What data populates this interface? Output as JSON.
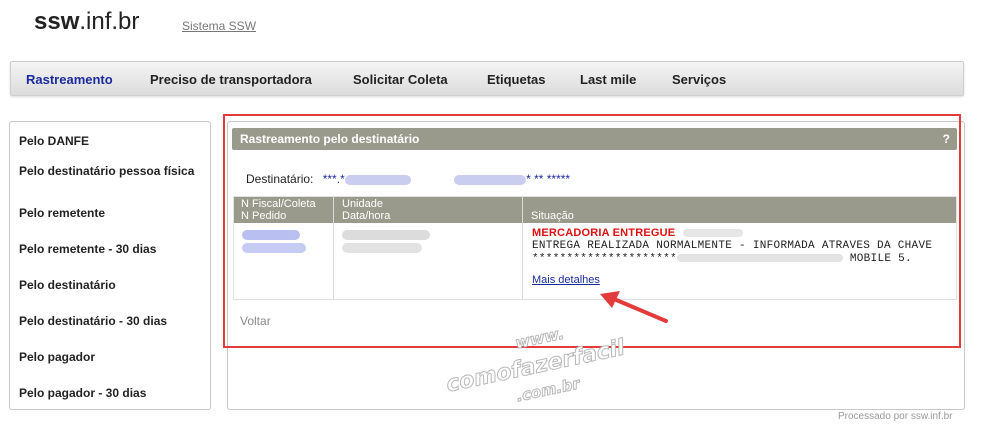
{
  "header": {
    "brand_bold": "ssw",
    "brand_rest": ".inf.br",
    "sys_link": "Sistema SSW"
  },
  "nav": {
    "items": [
      {
        "label": "Rastreamento",
        "active": true
      },
      {
        "label": "Preciso de transportadora"
      },
      {
        "label": "Solicitar Coleta"
      },
      {
        "label": "Etiquetas"
      },
      {
        "label": "Last mile"
      },
      {
        "label": "Serviços"
      }
    ]
  },
  "sidebar": {
    "items": [
      {
        "label": "Pelo DANFE"
      },
      {
        "label": "Pelo destinatário pessoa física"
      },
      {
        "label": "Pelo remetente"
      },
      {
        "label": "Pelo remetente - 30 dias"
      },
      {
        "label": "Pelo destinatário"
      },
      {
        "label": "Pelo destinatário - 30 dias"
      },
      {
        "label": "Pelo pagador"
      },
      {
        "label": "Pelo pagador - 30 dias"
      }
    ]
  },
  "panel": {
    "title": "Rastreamento pelo destinatário",
    "help": "?",
    "dest_label": "Destinatário:",
    "dest_value_prefix": "***.*",
    "dest_value_suffix": "* ** *****",
    "table": {
      "col1_line1": "N Fiscal/Coleta",
      "col1_line2": "N Pedido",
      "col2_line1": "Unidade",
      "col2_line2": "Data/hora",
      "col3": "Situação"
    },
    "row": {
      "status_title": "MERCADORIA ENTREGUE",
      "status_line1": "ENTREGA REALIZADA NORMALMENTE - INFORMADA ATRAVES DA CHAVE",
      "status_line2_prefix": "*********************",
      "status_line2_suffix": "MOBILE 5.",
      "details_link": "Mais detalhes"
    },
    "back": "Voltar"
  },
  "watermark": {
    "line1": "www.",
    "line2": "comofazerfacil",
    "line3": ".com.br"
  },
  "footer": "Processado por ssw.inf.br",
  "colors": {
    "accent": "#1a2b9c",
    "header_bg": "#9a9a8c",
    "highlight_frame": "#e23b3b",
    "status_red": "#dd1111"
  }
}
